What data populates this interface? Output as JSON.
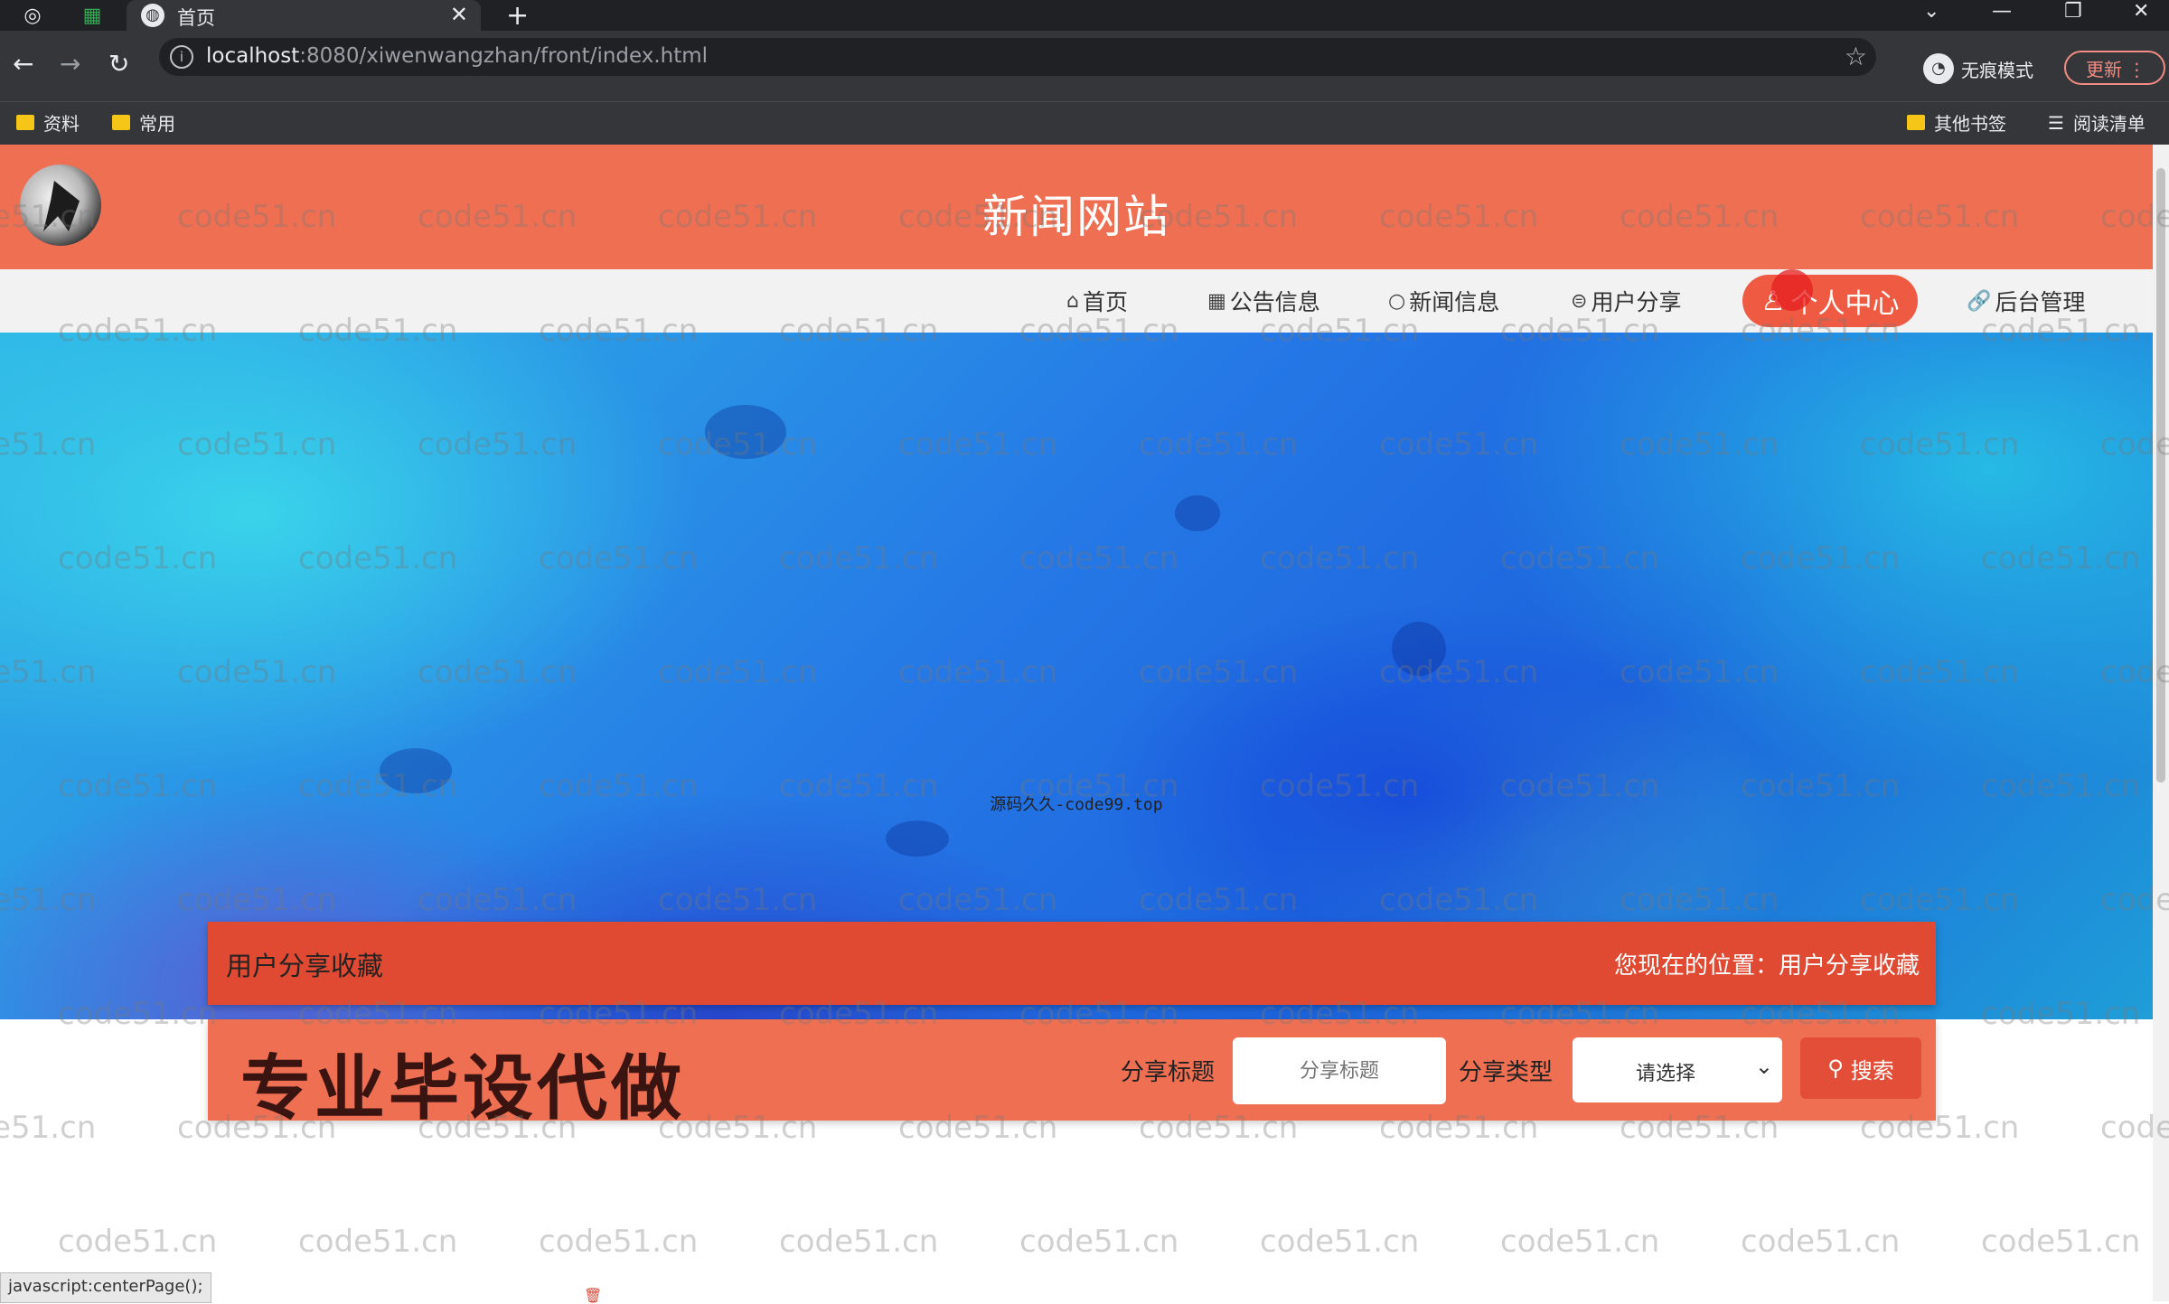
{
  "browser": {
    "tab_title": "首页",
    "url_host": "localhost",
    "url_rest": ":8080/xiwenwangzhan/front/index.html",
    "incognito_label": "无痕模式",
    "update_label": "更新",
    "bookmarks": [
      "资料",
      "常用"
    ],
    "other_bookmarks": "其他书签",
    "reading_list": "阅读清单"
  },
  "site": {
    "title": "新闻网站",
    "nav": [
      {
        "label": "首页",
        "icon": "home-icon"
      },
      {
        "label": "公告信息",
        "icon": "grid-icon"
      },
      {
        "label": "新闻信息",
        "icon": "chat-icon"
      },
      {
        "label": "用户分享",
        "icon": "share-icon"
      },
      {
        "label": "个人中心",
        "icon": "user-icon",
        "active": true
      },
      {
        "label": "后台管理",
        "icon": "link-icon"
      }
    ],
    "banner_caption": "源码久久-code99.top",
    "carousel": {
      "slides": 3,
      "active_index": 0
    }
  },
  "section": {
    "title": "用户分享收藏",
    "location_prefix": "您现在的位置：",
    "location_value": "用户分享收藏"
  },
  "search": {
    "promo": "专业毕设代做",
    "title_label": "分享标题",
    "title_placeholder": "分享标题",
    "type_label": "分享类型",
    "type_selected": "请选择",
    "search_label": "搜索"
  },
  "status_tip": "javascript:centerPage();",
  "watermark_text": "code51.cn",
  "colors": {
    "brand": "#ef6f52",
    "brand_dark": "#e04a33"
  }
}
